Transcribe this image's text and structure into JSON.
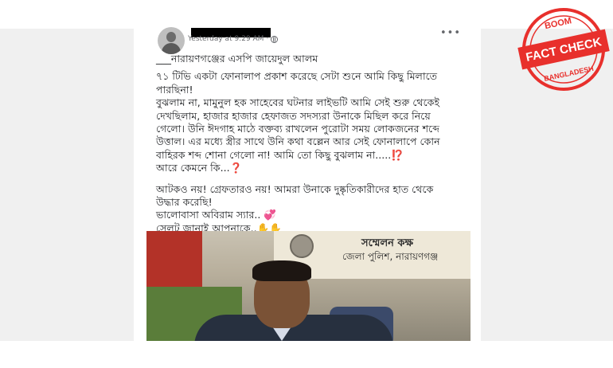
{
  "post": {
    "timestamp": "Yesterday at 9:29 AM",
    "privacy_separator": "·",
    "more_glyph": "•••",
    "lines": {
      "l1": "___নারায়ণগঞ্জের এসপি জায়েদুল আলম",
      "l2": "৭১ টিভি একটা ফোনালাপ প্রকাশ করেছে সেটা শুনে আমি কিছু মিলাতে",
      "l3": "পারছিনা!",
      "l4": "বুঝলাম না, মামুনুল হক সাহেবের ঘটনার  লাইভটি আমি সেই শুরু থেকেই",
      "l5": "দেখছিলাম, হাজার হাজার হেফাজত সদস্যরা উনাকে মিছিল করে নিয়ে",
      "l6": "গেলো। উনি ঈদগাহ মাঠে বক্তব্য রাখলেন পুরোটা সময় লোকজনের শব্দে",
      "l7": "উত্তাল। এর মধ্যে স্ত্রীর সাথে উনি কথা বল্লেন আর সেই ফোনালাপে কোন",
      "l8": "বাহিরক শব্দ শোনা গেলো না!  আমি তো কিছু বুঝলাম না.....⁉️",
      "l9": "আরে কেমনে কি...❓",
      "l10": "আটকও নয়! গ্রেফতারও নয়! আমরা উনাকে দুষ্কৃতিকারীদের হাত থেকে",
      "l11": "উদ্ধার করেছি!",
      "l12": "ভালোবাসা অবিরাম স্যার.. 💞",
      "l13": "সেলুট জানাই আপনাকে..✋✋"
    }
  },
  "photo": {
    "sign_line1": "সম্মেলন কক্ষ",
    "sign_line2": "জেলা পুলিশ, নারায়ণগঞ্জ"
  },
  "stamp": {
    "top_word": "BOOM",
    "main_text": "FACT CHECK",
    "bottom_word": "BANGLADESH",
    "color": "#e8302c"
  }
}
